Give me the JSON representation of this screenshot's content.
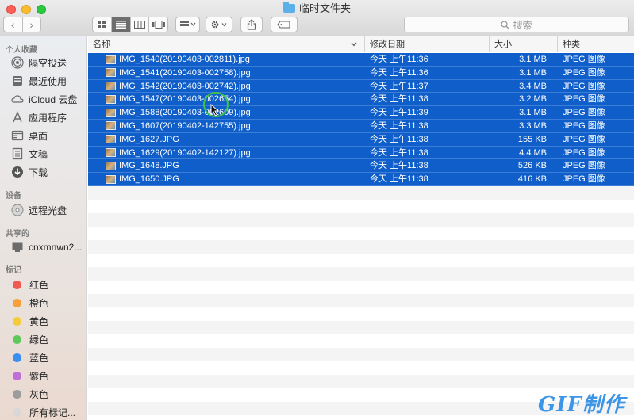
{
  "window": {
    "title": "临时文件夹"
  },
  "toolbar": {
    "back_glyph": "‹",
    "forward_glyph": "›",
    "view_modes": [
      "icon-view-icon",
      "list-view-icon",
      "column-view-icon",
      "gallery-view-icon"
    ],
    "active_view": "list-view-icon",
    "search_placeholder": "搜索"
  },
  "sidebar": {
    "favorites_title": "个人收藏",
    "favorites": [
      {
        "label": "隔空投送",
        "icon": "airdrop-icon"
      },
      {
        "label": "最近使用",
        "icon": "recents-icon"
      },
      {
        "label": "iCloud 云盘",
        "icon": "icloud-icon"
      },
      {
        "label": "应用程序",
        "icon": "applications-icon"
      },
      {
        "label": "桌面",
        "icon": "desktop-icon"
      },
      {
        "label": "文稿",
        "icon": "documents-icon"
      },
      {
        "label": "下载",
        "icon": "downloads-icon"
      }
    ],
    "devices_title": "设备",
    "devices": [
      {
        "label": "远程光盘",
        "icon": "disc-icon"
      }
    ],
    "shared_title": "共享的",
    "shared": [
      {
        "label": "cnxmnwn2...",
        "icon": "computer-icon"
      }
    ],
    "tags_title": "标记",
    "tags": [
      {
        "label": "红色",
        "color": "#f05b51"
      },
      {
        "label": "橙色",
        "color": "#f7a03a"
      },
      {
        "label": "黄色",
        "color": "#f5ca3b"
      },
      {
        "label": "绿色",
        "color": "#5fc85c"
      },
      {
        "label": "蓝色",
        "color": "#3b8ff0"
      },
      {
        "label": "紫色",
        "color": "#c06ed8"
      },
      {
        "label": "灰色",
        "color": "#9c9c9c"
      },
      {
        "label": "所有标记...",
        "color": "#d8d8d8"
      }
    ]
  },
  "columns": {
    "name": "名称",
    "modified": "修改日期",
    "size": "大小",
    "kind": "种类"
  },
  "files": [
    {
      "name": "IMG_1540(20190403-002811).jpg",
      "modified": "今天 上午11:36",
      "size": "3.1 MB",
      "kind": "JPEG 图像"
    },
    {
      "name": "IMG_1541(20190403-002758).jpg",
      "modified": "今天 上午11:36",
      "size": "3.1 MB",
      "kind": "JPEG 图像"
    },
    {
      "name": "IMG_1542(20190403-002742).jpg",
      "modified": "今天 上午11:37",
      "size": "3.4 MB",
      "kind": "JPEG 图像"
    },
    {
      "name": "IMG_1547(20190403-002654).jpg",
      "modified": "今天 上午11:38",
      "size": "3.2 MB",
      "kind": "JPEG 图像"
    },
    {
      "name": "IMG_1588(20190403-002609).jpg",
      "modified": "今天 上午11:39",
      "size": "3.1 MB",
      "kind": "JPEG 图像"
    },
    {
      "name": "IMG_1607(20190402-142755).jpg",
      "modified": "今天 上午11:38",
      "size": "3.3 MB",
      "kind": "JPEG 图像"
    },
    {
      "name": "IMG_1627.JPG",
      "modified": "今天 上午11:38",
      "size": "155 KB",
      "kind": "JPEG 图像"
    },
    {
      "name": "IMG_1629(20190402-142127).jpg",
      "modified": "今天 上午11:38",
      "size": "4.4 MB",
      "kind": "JPEG 图像"
    },
    {
      "name": "IMG_1648.JPG",
      "modified": "今天 上午11:38",
      "size": "526 KB",
      "kind": "JPEG 图像"
    },
    {
      "name": "IMG_1650.JPG",
      "modified": "今天 上午11:38",
      "size": "416 KB",
      "kind": "JPEG 图像"
    }
  ],
  "watermark": "GIF制作"
}
